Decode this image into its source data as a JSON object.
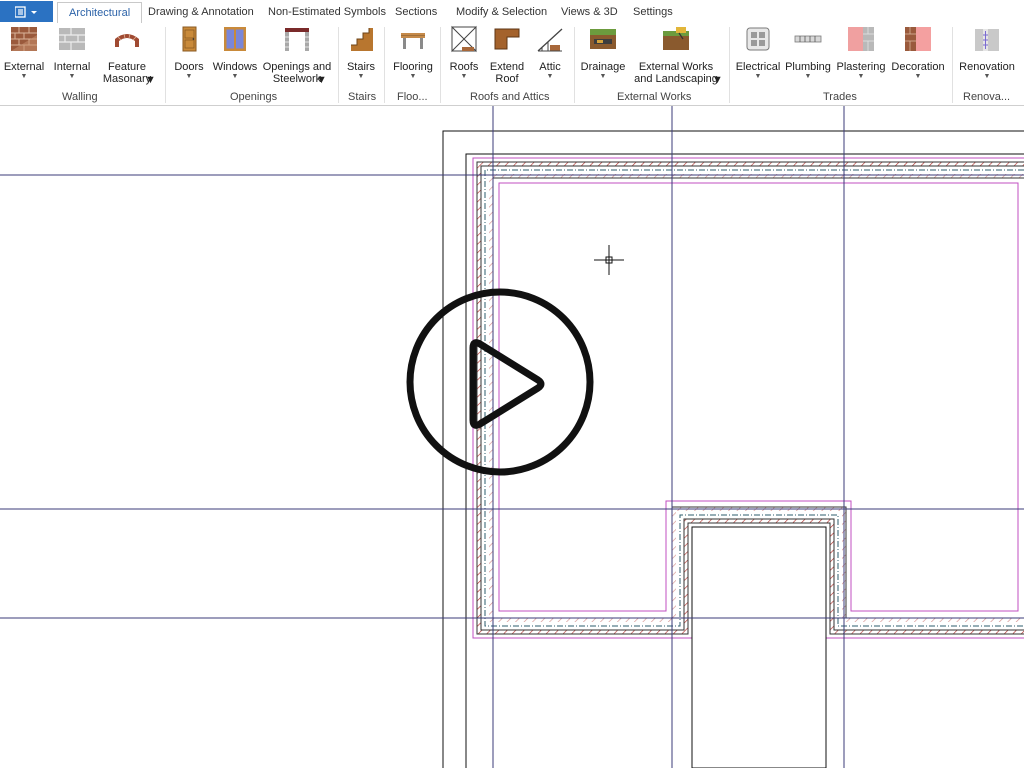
{
  "tabs": [
    {
      "label": "Architectural",
      "active": true
    },
    {
      "label": "Drawing & Annotation"
    },
    {
      "label": "Non-Estimated Symbols"
    },
    {
      "label": "Sections"
    },
    {
      "label": "Modify & Selection"
    },
    {
      "label": "Views & 3D"
    },
    {
      "label": "Settings"
    }
  ],
  "ribbon": {
    "buttons": [
      {
        "label": "External",
        "icon": "brick-wall-icon"
      },
      {
        "label": "Internal",
        "icon": "block-wall-icon"
      },
      {
        "label": "Feature\nMasonary",
        "icon": "feature-arch-icon"
      },
      {
        "label": "Doors",
        "icon": "door-icon"
      },
      {
        "label": "Windows",
        "icon": "window-icon"
      },
      {
        "label": "Openings and\nSteelwork",
        "icon": "steel-opening-icon"
      },
      {
        "label": "Stairs",
        "icon": "stairs-icon"
      },
      {
        "label": "Flooring",
        "icon": "flooring-icon"
      },
      {
        "label": "Roofs",
        "icon": "roof-icon"
      },
      {
        "label": "Extend\nRoof",
        "icon": "extend-roof-icon"
      },
      {
        "label": "Attic",
        "icon": "attic-icon"
      },
      {
        "label": "Drainage",
        "icon": "drainage-icon"
      },
      {
        "label": "External Works\nand Landscaping",
        "icon": "landscaping-icon"
      },
      {
        "label": "Electrical",
        "icon": "electrical-icon"
      },
      {
        "label": "Plumbing",
        "icon": "plumbing-icon"
      },
      {
        "label": "Plastering",
        "icon": "plastering-icon"
      },
      {
        "label": "Decoration",
        "icon": "decoration-icon"
      },
      {
        "label": "Renovation",
        "icon": "renovation-icon"
      }
    ],
    "groups": [
      "Walling",
      "Openings",
      "Stairs",
      "Floo...",
      "Roofs and Attics",
      "External Works",
      "Trades",
      "Renova..."
    ]
  },
  "overlay": {
    "icon": "play-button-icon"
  },
  "colors": {
    "accent": "#2b72c2",
    "tab_active_text": "#2b62a8",
    "wall_hatch": "#b0332e",
    "magenta_line": "#c04fc0",
    "grid_line": "#3b3b7a"
  }
}
